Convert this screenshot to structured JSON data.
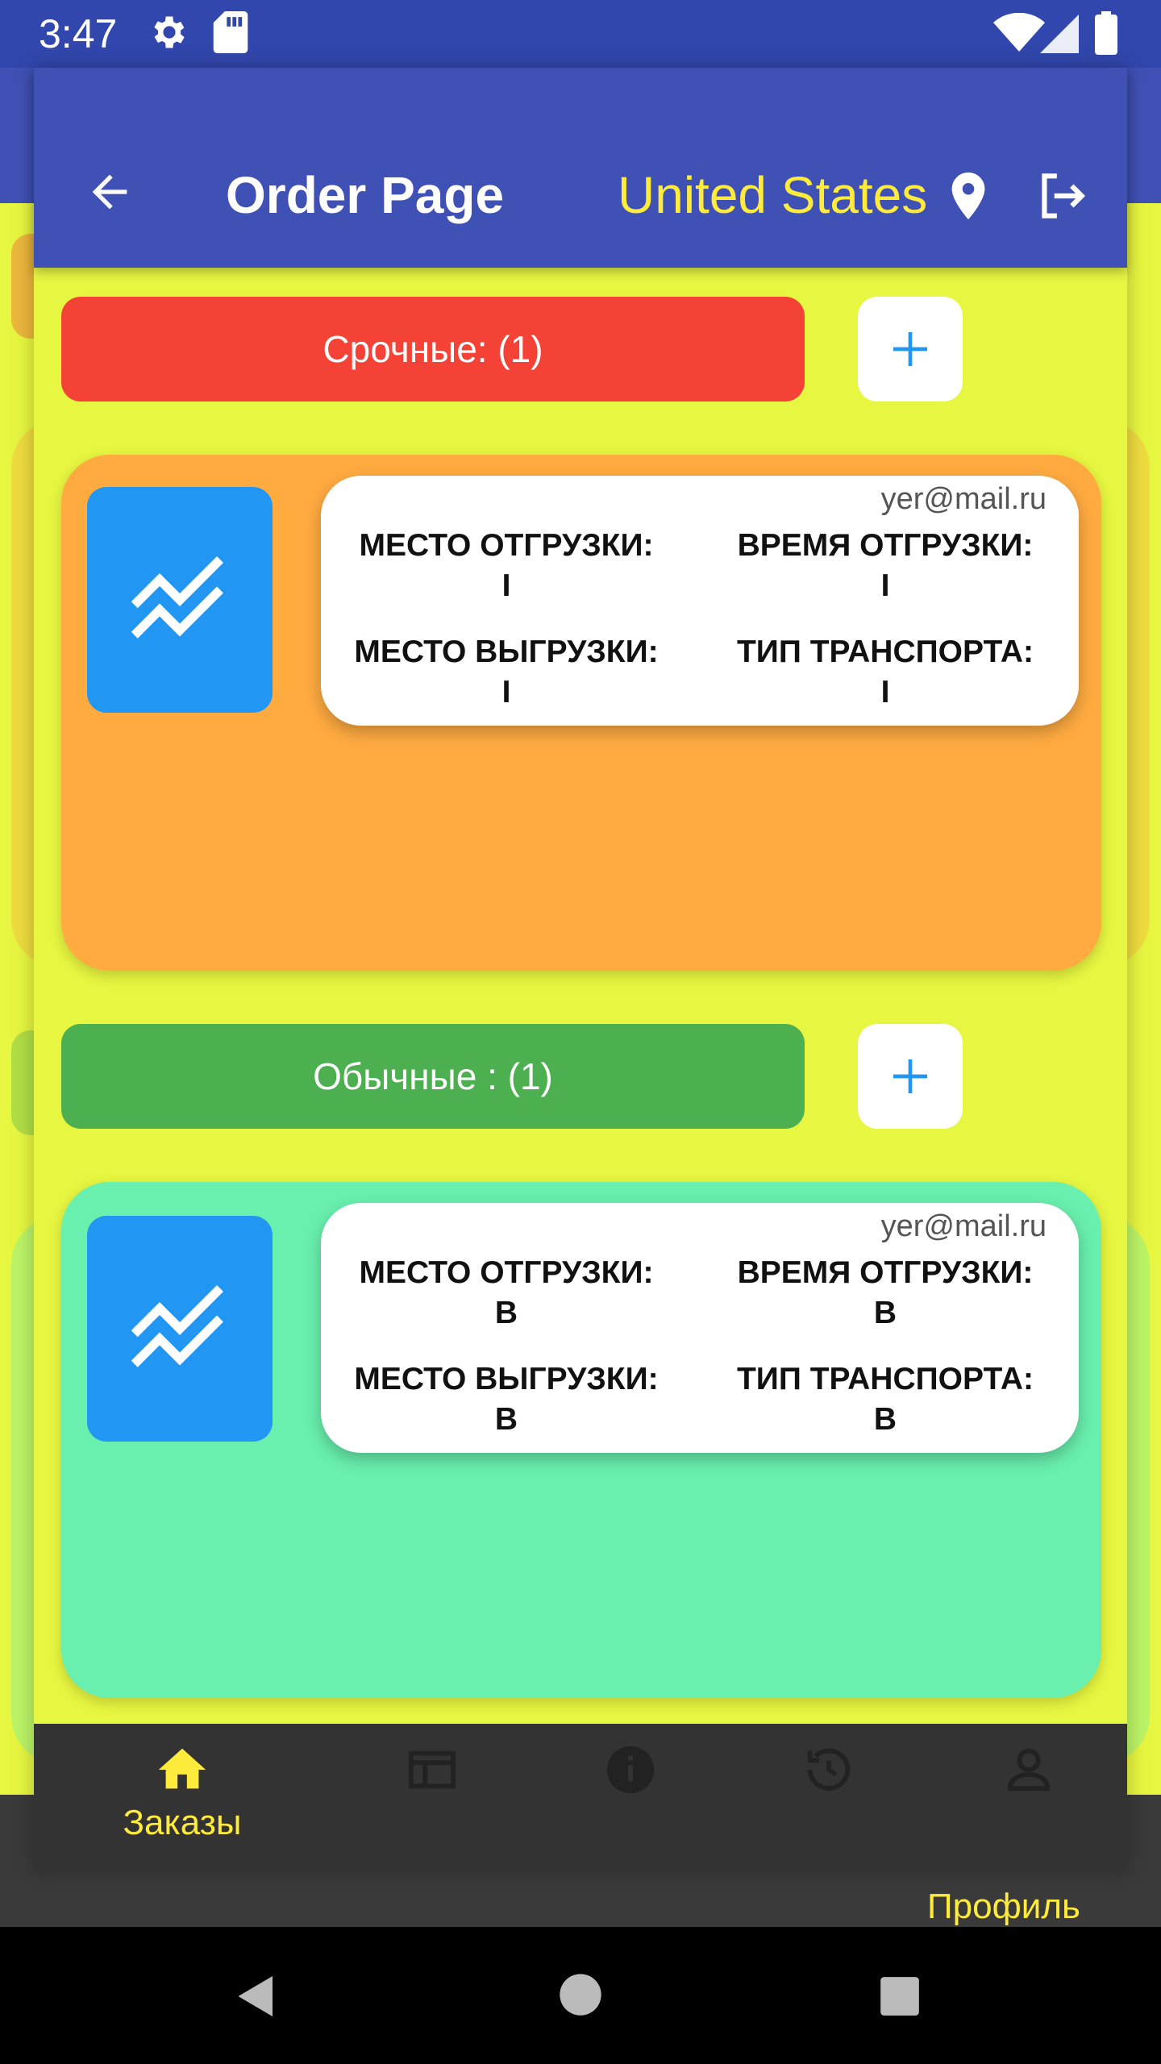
{
  "status_bar": {
    "time": "3:47"
  },
  "app_bar": {
    "title": "Order Page",
    "country": "United States"
  },
  "sections": [
    {
      "label": "Срочные: (1)",
      "color": "#f44336",
      "card_color": "#ffab40",
      "order": {
        "email": "yer@mail.ru",
        "fields": [
          {
            "label": "МЕСТО ОТГРУЗКИ:",
            "value": "I"
          },
          {
            "label": "ВРЕМЯ ОТГРУЗКИ:",
            "value": "I"
          },
          {
            "label": "МЕСТО ВЫГРУЗКИ:",
            "value": "I"
          },
          {
            "label": "ТИП ТРАНСПОРТА:",
            "value": "I"
          }
        ]
      }
    },
    {
      "label": "Обычные : (1)",
      "color": "#4caf50",
      "card_color": "#69f0ae",
      "order": {
        "email": "yer@mail.ru",
        "fields": [
          {
            "label": "МЕСТО ОТГРУЗКИ:",
            "value": "B"
          },
          {
            "label": "ВРЕМЯ ОТГРУЗКИ:",
            "value": "B"
          },
          {
            "label": "МЕСТО ВЫГРУЗКИ:",
            "value": "B"
          },
          {
            "label": "ТИП ТРАНСПОРТА:",
            "value": "B"
          }
        ]
      }
    }
  ],
  "bottom_nav": {
    "active_label": "Заказы",
    "ghost_active_label": "Профиль",
    "items": [
      "home-icon",
      "news-icon",
      "info-icon",
      "history-icon",
      "profile-icon"
    ]
  },
  "colors": {
    "primary": "#3f51b5",
    "accent": "#ffeb3b",
    "background": "#e7f640",
    "icon_blue": "#2196f3"
  }
}
